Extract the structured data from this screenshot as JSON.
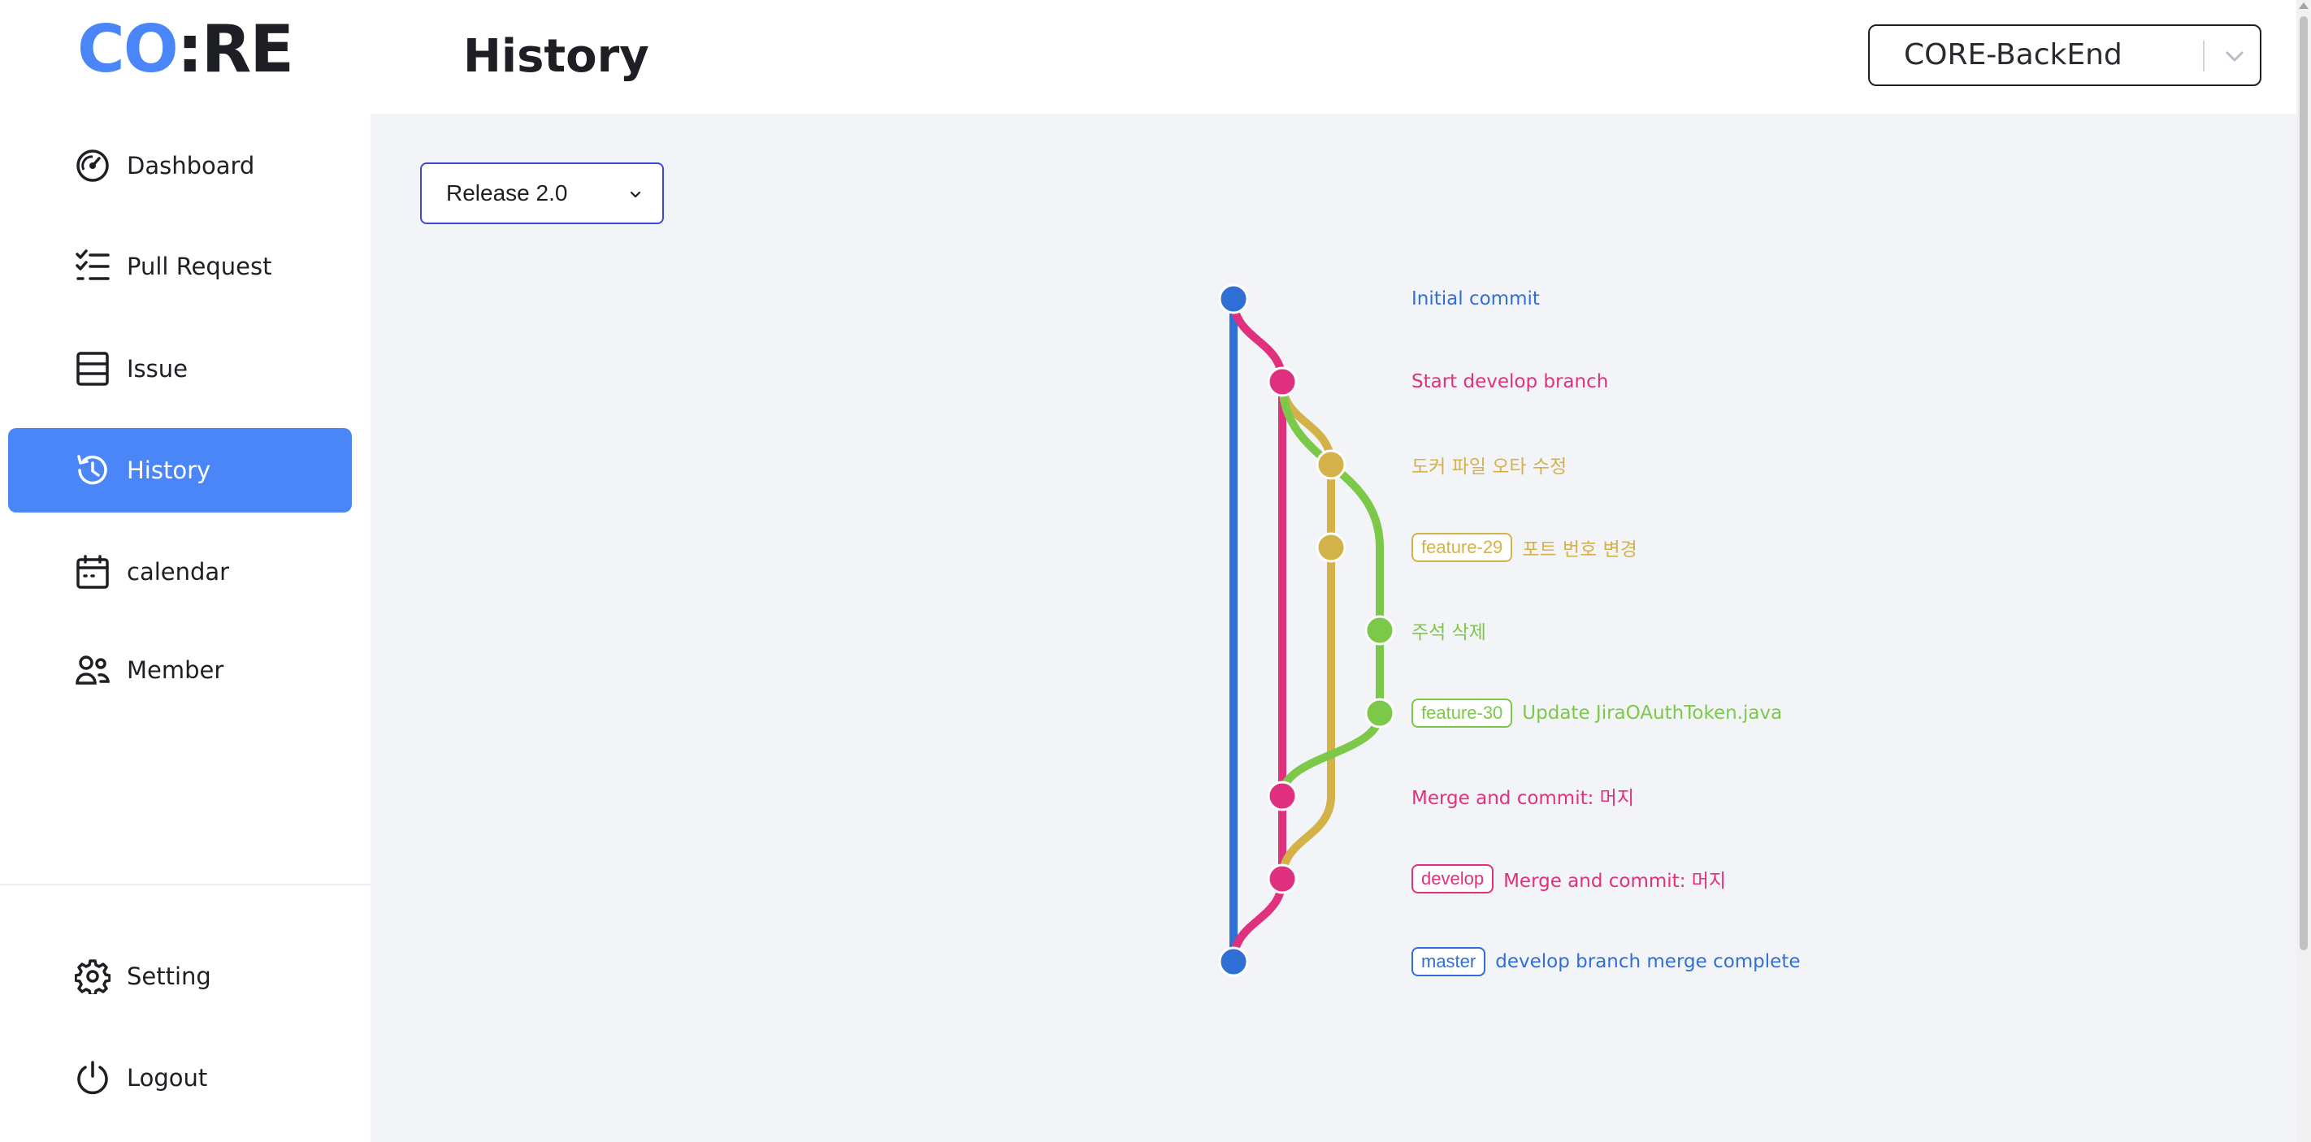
{
  "app": {
    "logo_part1": "CO",
    "logo_part2": ":RE"
  },
  "sidebar": {
    "items": [
      {
        "label": "Dashboard",
        "icon": "gauge-icon"
      },
      {
        "label": "Pull Request",
        "icon": "checklist-icon"
      },
      {
        "label": "Issue",
        "icon": "table-icon"
      },
      {
        "label": "History",
        "icon": "history-icon",
        "active": true
      },
      {
        "label": "calendar",
        "icon": "calendar-icon"
      },
      {
        "label": "Member",
        "icon": "users-icon"
      }
    ],
    "bottom": [
      {
        "label": "Setting",
        "icon": "gear-icon"
      },
      {
        "label": "Logout",
        "icon": "power-icon"
      }
    ]
  },
  "header": {
    "title": "History",
    "project_select": "CORE-BackEnd"
  },
  "release_select": "Release 2.0",
  "colors": {
    "accent": "#4a86f7",
    "master": "#2f6fd6",
    "develop": "#e0317e",
    "feature29": "#d4b24a",
    "feature30": "#7cc94a"
  },
  "commits": [
    {
      "message": "Initial commit",
      "branch": "master",
      "tag": ""
    },
    {
      "message": "Start develop branch",
      "branch": "develop",
      "tag": ""
    },
    {
      "message": "도커 파일 오타 수정",
      "branch": "feature29",
      "tag": ""
    },
    {
      "message": "포트 번호 변경",
      "branch": "feature29",
      "tag": "feature-29"
    },
    {
      "message": "주석 삭제",
      "branch": "feature30",
      "tag": ""
    },
    {
      "message": "Update JiraOAuthToken.java",
      "branch": "feature30",
      "tag": "feature-30"
    },
    {
      "message": "Merge and commit: 머지",
      "branch": "develop",
      "tag": ""
    },
    {
      "message": "Merge and commit: 머지",
      "branch": "develop",
      "tag": "develop"
    },
    {
      "message": "develop branch merge complete",
      "branch": "master",
      "tag": "master"
    }
  ]
}
